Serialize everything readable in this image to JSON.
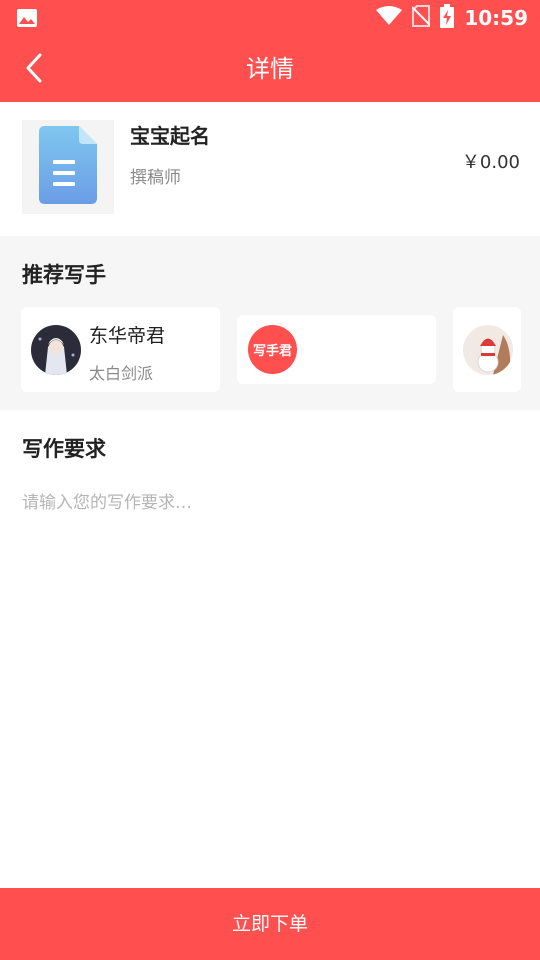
{
  "status_bar": {
    "time": "10:59",
    "icons": [
      "image-icon",
      "wifi-icon",
      "no-sim-icon",
      "battery-charging-icon"
    ]
  },
  "header": {
    "title": "详情",
    "back_icon": "chevron-left-icon"
  },
  "product": {
    "icon": "document-icon",
    "title": "宝宝起名",
    "subtitle": "撰稿师",
    "price": "￥0.00"
  },
  "recommended": {
    "title": "推荐写手",
    "writers": [
      {
        "name": "东华帝君",
        "school": "太白剑派",
        "avatar": "character-avatar"
      },
      {
        "name": "",
        "school": "",
        "avatar_text": "写手君"
      },
      {
        "name": "",
        "school": "",
        "avatar": "snowman-avatar"
      }
    ]
  },
  "requirements": {
    "title": "写作要求",
    "placeholder": "请输入您的写作要求…",
    "value": ""
  },
  "footer": {
    "submit_label": "立即下单"
  },
  "colors": {
    "primary": "#ff4f4f",
    "section_bg": "#f6f6f6"
  }
}
